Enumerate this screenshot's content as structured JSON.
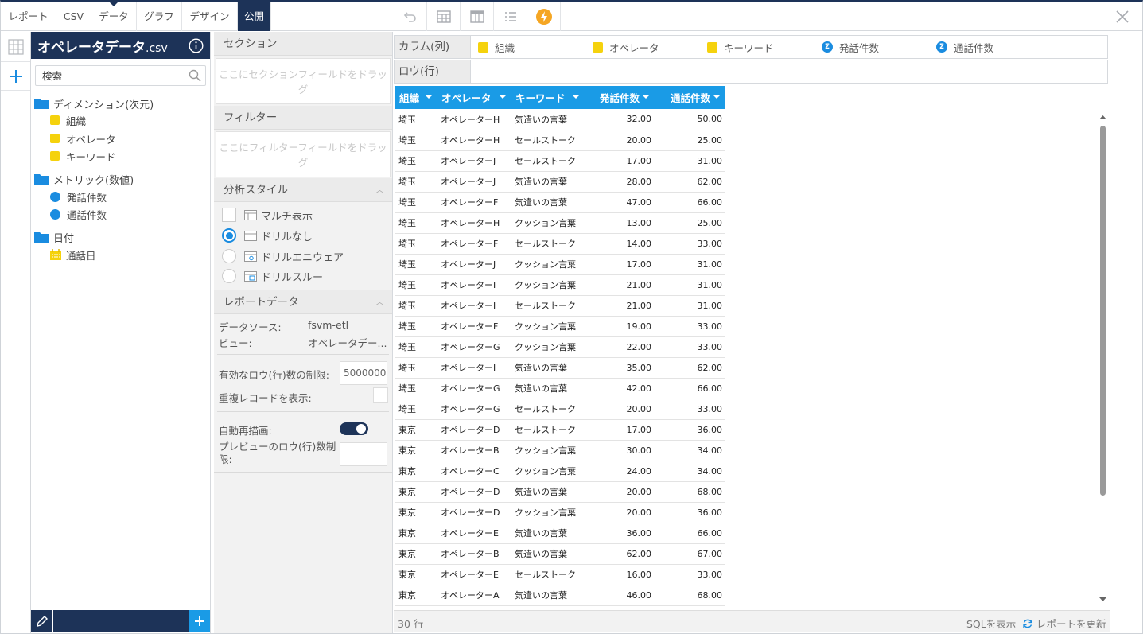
{
  "toolbar": {
    "tabs": [
      "レポート",
      "CSV",
      "データ",
      "グラフ",
      "デザイン",
      "公開"
    ],
    "active_tab": "公開"
  },
  "colors": {
    "navy": "#1d3358",
    "accent": "#1a9be6",
    "yellow": "#f5d20d",
    "icon_blue": "#1a8ce0"
  },
  "fields": {
    "title": "オペレータデータ",
    "title_ext": ".csv",
    "search_placeholder": "検索",
    "dimensions_label": "ディメンション(次元)",
    "dimensions": [
      "組織",
      "オペレータ",
      "キーワード"
    ],
    "metrics_label": "メトリック(数値)",
    "metrics": [
      "発話件数",
      "通話件数"
    ],
    "date_label": "日付",
    "dates": [
      "通話日"
    ]
  },
  "config": {
    "section_label": "セクション",
    "section_drop": "ここにセクションフィールドをドラッグ",
    "filter_label": "フィルター",
    "filter_drop": "ここにフィルターフィールドをドラッグ",
    "analysis_label": "分析スタイル",
    "analysis_options": [
      "マルチ表示",
      "ドリルなし",
      "ドリルエニウェア",
      "ドリルスルー"
    ],
    "analysis_selected": "ドリルなし",
    "report_data_label": "レポートデータ",
    "datasource_key": "データソース:",
    "datasource_value": "fsvm-etl",
    "view_key": "ビュー:",
    "view_value": "オペレータデー...",
    "row_limit_label": "有効なロウ(行)数の制限:",
    "row_limit_value": "5000000",
    "show_dup_label": "重複レコードを表示:",
    "auto_redraw_label": "自動再描画:",
    "auto_redraw_on": true,
    "preview_limit_label": "プレビューのロウ(行)数制限:",
    "preview_limit_value": ""
  },
  "shelves": {
    "column_label": "カラム(列)",
    "row_label": "ロウ(行)",
    "columns": [
      {
        "name": "組織",
        "kind": "dimension"
      },
      {
        "name": "オペレータ",
        "kind": "dimension"
      },
      {
        "name": "キーワード",
        "kind": "dimension"
      },
      {
        "name": "発話件数",
        "kind": "metric"
      },
      {
        "name": "通話件数",
        "kind": "metric"
      }
    ]
  },
  "table": {
    "headers": [
      "組織",
      "オペレータ",
      "キーワード",
      "発話件数",
      "通話件数"
    ],
    "rows": [
      [
        "埼玉",
        "オペレーターH",
        "気遣いの言葉",
        "32.00",
        "50.00"
      ],
      [
        "埼玉",
        "オペレーターH",
        "セールストーク",
        "20.00",
        "25.00"
      ],
      [
        "埼玉",
        "オペレーターJ",
        "セールストーク",
        "17.00",
        "31.00"
      ],
      [
        "埼玉",
        "オペレーターJ",
        "気遣いの言葉",
        "28.00",
        "62.00"
      ],
      [
        "埼玉",
        "オペレーターF",
        "気遣いの言葉",
        "47.00",
        "66.00"
      ],
      [
        "埼玉",
        "オペレーターH",
        "クッション言葉",
        "13.00",
        "25.00"
      ],
      [
        "埼玉",
        "オペレーターF",
        "セールストーク",
        "14.00",
        "33.00"
      ],
      [
        "埼玉",
        "オペレーターJ",
        "クッション言葉",
        "17.00",
        "31.00"
      ],
      [
        "埼玉",
        "オペレーターI",
        "クッション言葉",
        "21.00",
        "31.00"
      ],
      [
        "埼玉",
        "オペレーターI",
        "セールストーク",
        "21.00",
        "31.00"
      ],
      [
        "埼玉",
        "オペレーターF",
        "クッション言葉",
        "19.00",
        "33.00"
      ],
      [
        "埼玉",
        "オペレーターG",
        "クッション言葉",
        "22.00",
        "33.00"
      ],
      [
        "埼玉",
        "オペレーターI",
        "気遣いの言葉",
        "35.00",
        "62.00"
      ],
      [
        "埼玉",
        "オペレーターG",
        "気遣いの言葉",
        "42.00",
        "66.00"
      ],
      [
        "埼玉",
        "オペレーターG",
        "セールストーク",
        "20.00",
        "33.00"
      ],
      [
        "東京",
        "オペレーターD",
        "セールストーク",
        "17.00",
        "36.00"
      ],
      [
        "東京",
        "オペレーターB",
        "クッション言葉",
        "30.00",
        "34.00"
      ],
      [
        "東京",
        "オペレーターC",
        "クッション言葉",
        "24.00",
        "34.00"
      ],
      [
        "東京",
        "オペレーターD",
        "気遣いの言葉",
        "20.00",
        "68.00"
      ],
      [
        "東京",
        "オペレーターD",
        "クッション言葉",
        "20.00",
        "36.00"
      ],
      [
        "東京",
        "オペレーターE",
        "気遣いの言葉",
        "36.00",
        "66.00"
      ],
      [
        "東京",
        "オペレーターB",
        "気遣いの言葉",
        "62.00",
        "67.00"
      ],
      [
        "東京",
        "オペレーターE",
        "セールストーク",
        "16.00",
        "33.00"
      ],
      [
        "東京",
        "オペレーターA",
        "気遣いの言葉",
        "46.00",
        "68.00"
      ]
    ]
  },
  "status": {
    "row_count": "30 行",
    "show_sql": "SQLを表示",
    "refresh": "レポートを更新"
  }
}
